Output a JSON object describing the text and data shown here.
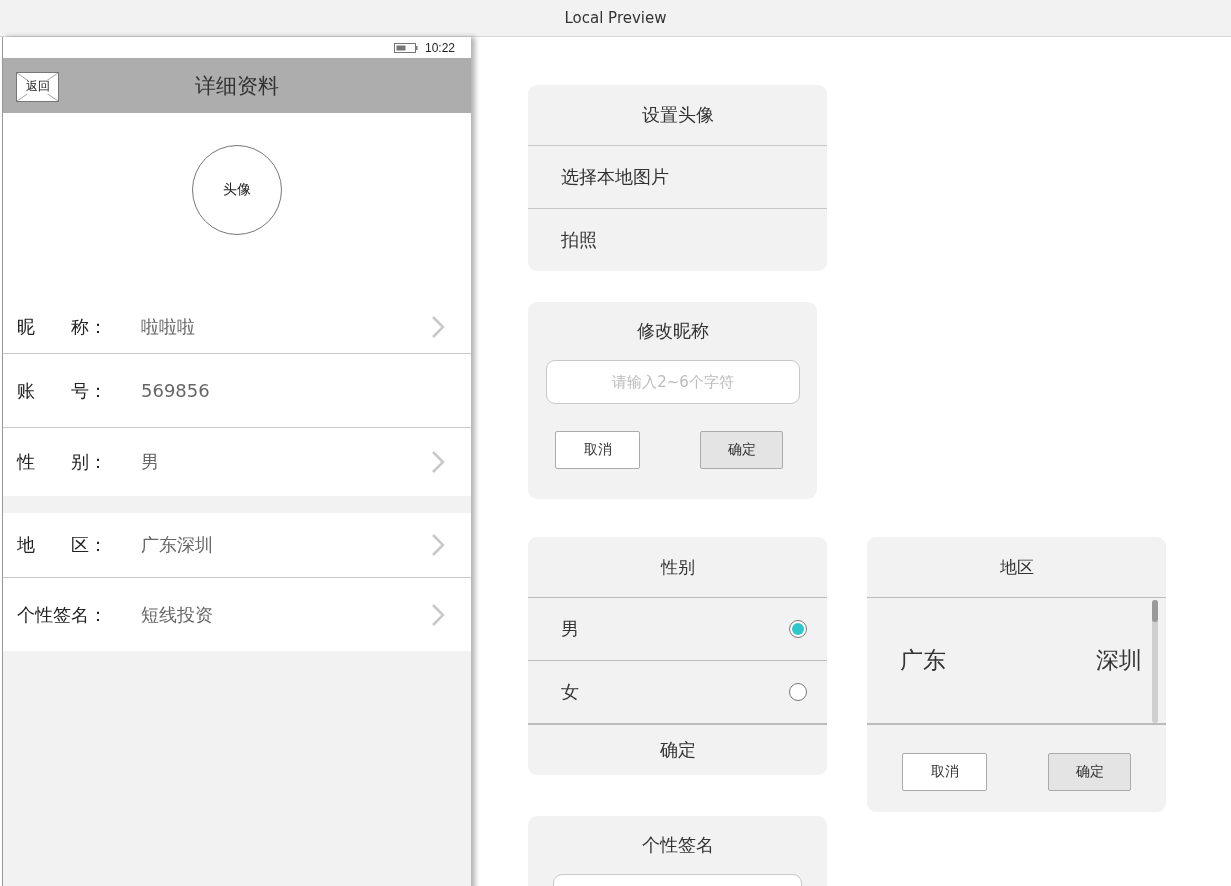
{
  "window": {
    "title": "Local Preview"
  },
  "phone": {
    "status_bar": {
      "time": "10:22"
    },
    "header": {
      "back": "返回",
      "title": "详细资料"
    },
    "avatar": "头像",
    "groups": [
      [
        {
          "label": "昵　　称：",
          "value": "啦啦啦",
          "chevron": true
        },
        {
          "label": "账　　号：",
          "value": "569856",
          "chevron": false
        },
        {
          "label": "性　　别：",
          "value": "男",
          "chevron": true
        }
      ],
      [
        {
          "label": "地　　区：",
          "value": "广东深圳",
          "chevron": true
        },
        {
          "label": "个性签名：",
          "value": "短线投资",
          "chevron": true
        }
      ]
    ]
  },
  "avatar_sheet": {
    "title": "设置头像",
    "options": [
      "选择本地图片",
      "拍照"
    ]
  },
  "nickname_dialog": {
    "title": "修改昵称",
    "placeholder": "请输入2~6个字符",
    "buttons": [
      {
        "label": "取消",
        "primary": false
      },
      {
        "label": "确定",
        "primary": true
      }
    ]
  },
  "gender_picker": {
    "title": "性别",
    "options": [
      {
        "label": "男",
        "selected": true
      },
      {
        "label": "女",
        "selected": false
      }
    ],
    "confirm": "确定"
  },
  "region_picker": {
    "title": "地区",
    "province": "广东",
    "city": "深圳",
    "buttons": [
      {
        "label": "取消",
        "primary": false
      },
      {
        "label": "确定",
        "primary": true
      }
    ]
  },
  "signature_dialog": {
    "title": "个性签名"
  }
}
